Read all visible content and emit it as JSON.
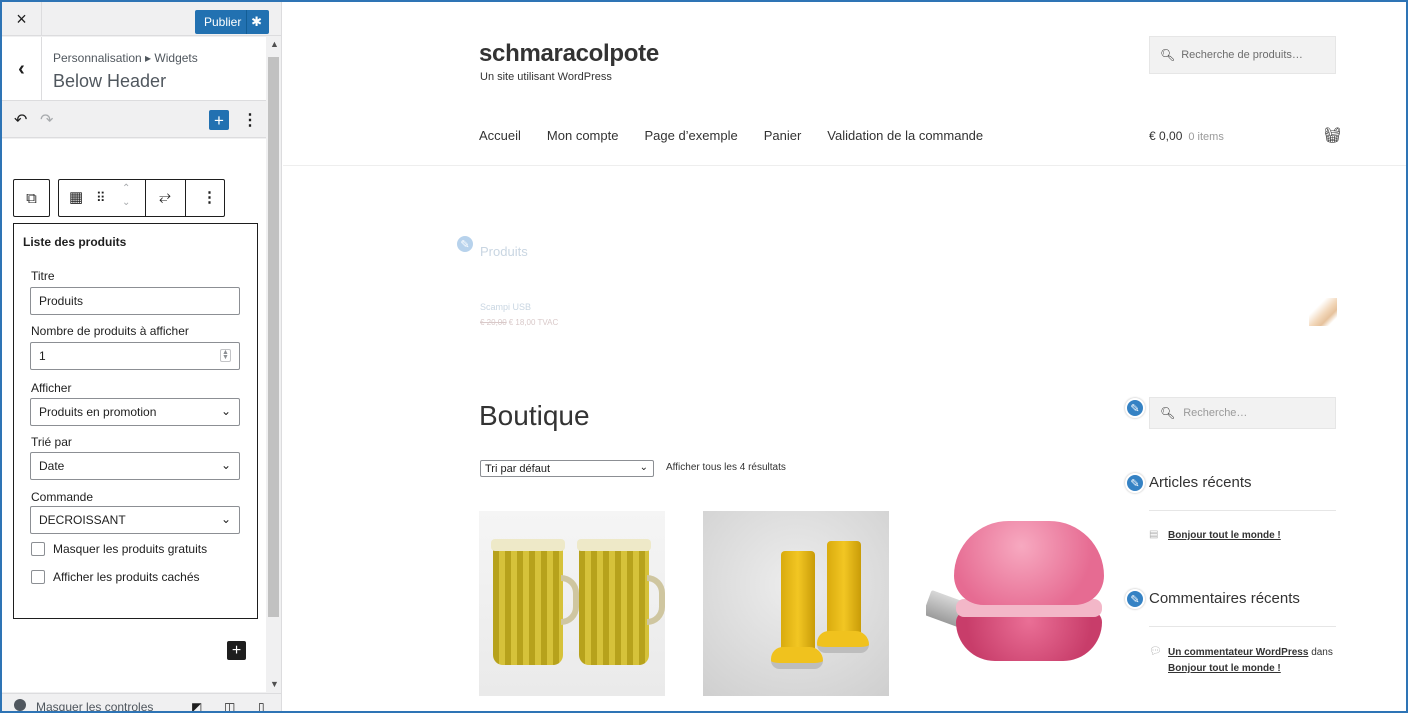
{
  "sidebar": {
    "close_icon": "×",
    "publish_label": "Publier",
    "back_icon": "‹",
    "breadcrumb": "Personnalisation ▸ Widgets",
    "title": "Below Header",
    "toolbar": {
      "undo": "↶",
      "redo": "↷",
      "add": "+",
      "options": "⋮"
    },
    "block_toolbar": {
      "parent": "⧉",
      "block": "📅",
      "drag": "⠿",
      "move": "⌃⌄",
      "transform": "⥂",
      "more": "⋮"
    },
    "widget": {
      "title": "Liste des produits",
      "fields": {
        "title_label": "Titre",
        "title_value": "Produits",
        "count_label": "Nombre de produits à afficher",
        "count_value": "1",
        "show_label": "Afficher",
        "show_value": "Produits en promotion",
        "orderby_label": "Trié par",
        "orderby_value": "Date",
        "order_label": "Commande",
        "order_value": "DECROISSANT"
      },
      "checkboxes": [
        {
          "label": "Masquer les produits gratuits",
          "checked": false
        },
        {
          "label": "Afficher les produits cachés",
          "checked": false
        }
      ]
    },
    "add_block": "+",
    "footer": {
      "hide_controls": "Masquer les controles"
    }
  },
  "preview": {
    "site_title": "schmaracolpote",
    "tagline": "Un site utilisant WordPress",
    "search_placeholder": "Recherche de produits…",
    "nav": [
      "Accueil",
      "Mon compte",
      "Page d’exemple",
      "Panier",
      "Validation de la commande"
    ],
    "cart": {
      "amount": "€ 0,00",
      "items": "0 items"
    },
    "products_widget": {
      "title": "Produits",
      "product_name": "Scampi USB",
      "old_price": "€ 20,00",
      "new_price": "€ 18,00",
      "tax": "TVAC"
    },
    "shop": {
      "title": "Boutique",
      "sort_value": "Tri par défaut",
      "results_text": "Afficher tous les 4 résultats"
    },
    "sidebar_widgets": {
      "search_placeholder": "Recherche…",
      "recent_posts_title": "Articles récents",
      "recent_post": "Bonjour tout le monde !",
      "recent_comments_title": "Commentaires récents",
      "comment_author": "Un commentateur WordPress",
      "comment_connector": "dans",
      "comment_post": "Bonjour tout le monde !"
    }
  },
  "colors": {
    "accent": "#2271b1",
    "frame": "#2e74b5",
    "edit_pencil": "#3582c4"
  }
}
